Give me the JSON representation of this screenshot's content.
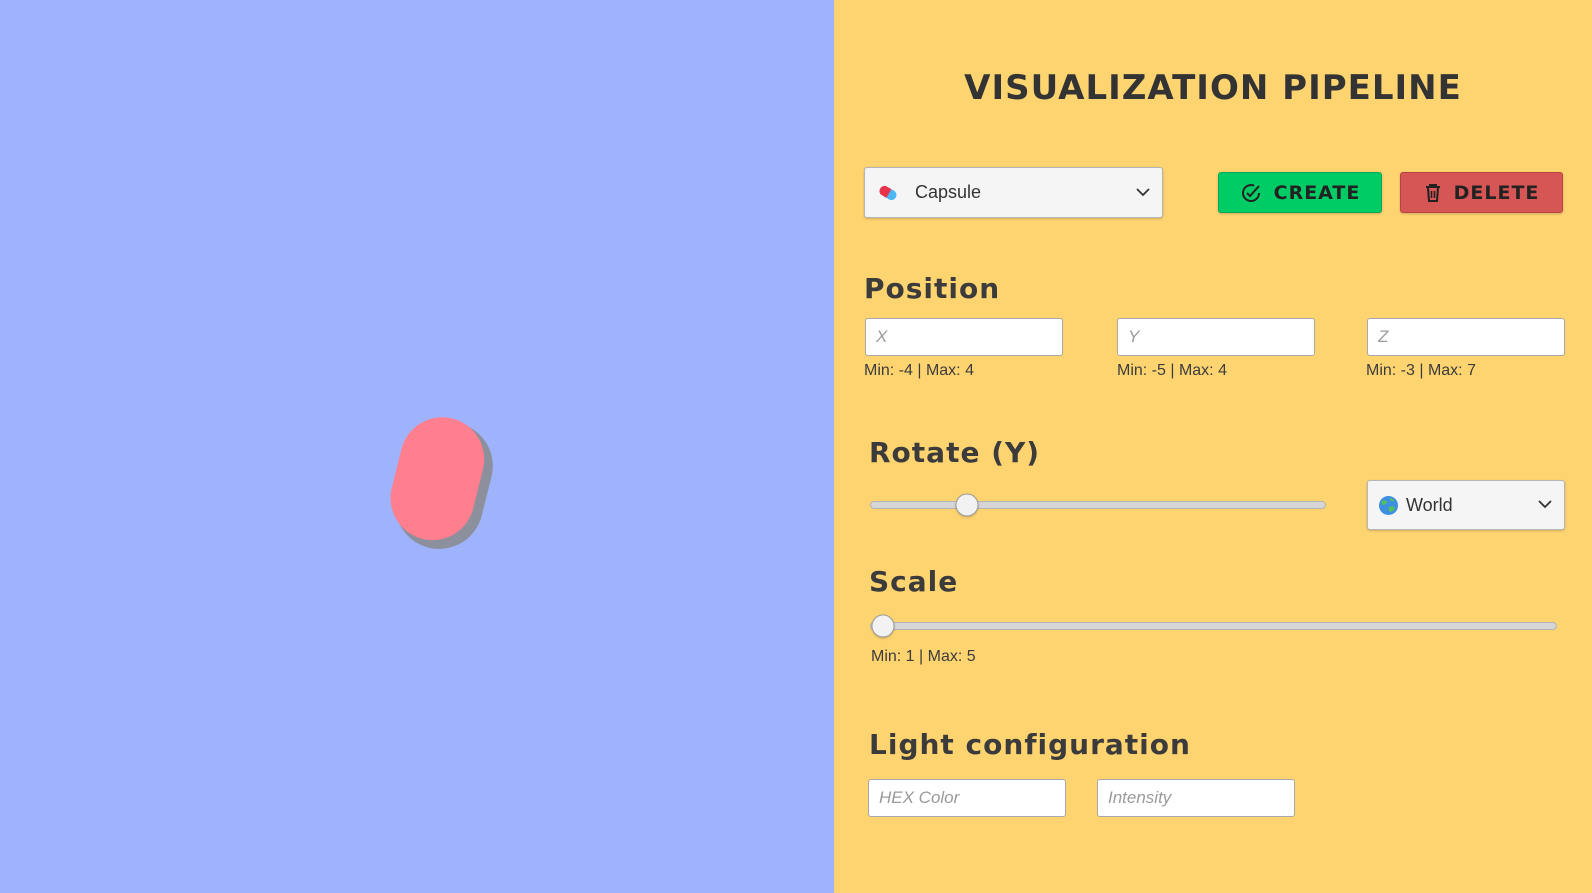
{
  "panel": {
    "title": "VISUALIZATION PIPELINE"
  },
  "viewport": {
    "object": "capsule",
    "object_color": "#ff7f8e",
    "background_color": "#9fb3fd"
  },
  "shape_select": {
    "selected": "Capsule",
    "icon": "pill-icon"
  },
  "buttons": {
    "create_label": "CREATE",
    "create_icon": "check-circle-icon",
    "delete_label": "DELETE",
    "delete_icon": "trash-icon"
  },
  "position": {
    "title": "Position",
    "x": {
      "value": "",
      "placeholder": "X",
      "hint": "Min: -4 | Max: 4"
    },
    "y": {
      "value": "",
      "placeholder": "Y",
      "hint": "Min: -5 | Max: 4"
    },
    "z": {
      "value": "",
      "placeholder": "Z",
      "hint": "Min: -3 | Max: 7"
    }
  },
  "rotate": {
    "title": "Rotate (Y)",
    "slider_fraction": 0.195,
    "space_select": "World",
    "space_icon": "globe-icon"
  },
  "scale": {
    "title": "Scale",
    "slider_fraction": 0.0,
    "hint": "Min: 1 | Max: 5"
  },
  "light": {
    "title": "Light configuration",
    "color": {
      "value": "",
      "placeholder": "HEX Color"
    },
    "intensity": {
      "value": "",
      "placeholder": "Intensity"
    }
  },
  "colors": {
    "panel_bg": "#fed471",
    "create_button": "#00cc66",
    "delete_button": "#d65555"
  }
}
